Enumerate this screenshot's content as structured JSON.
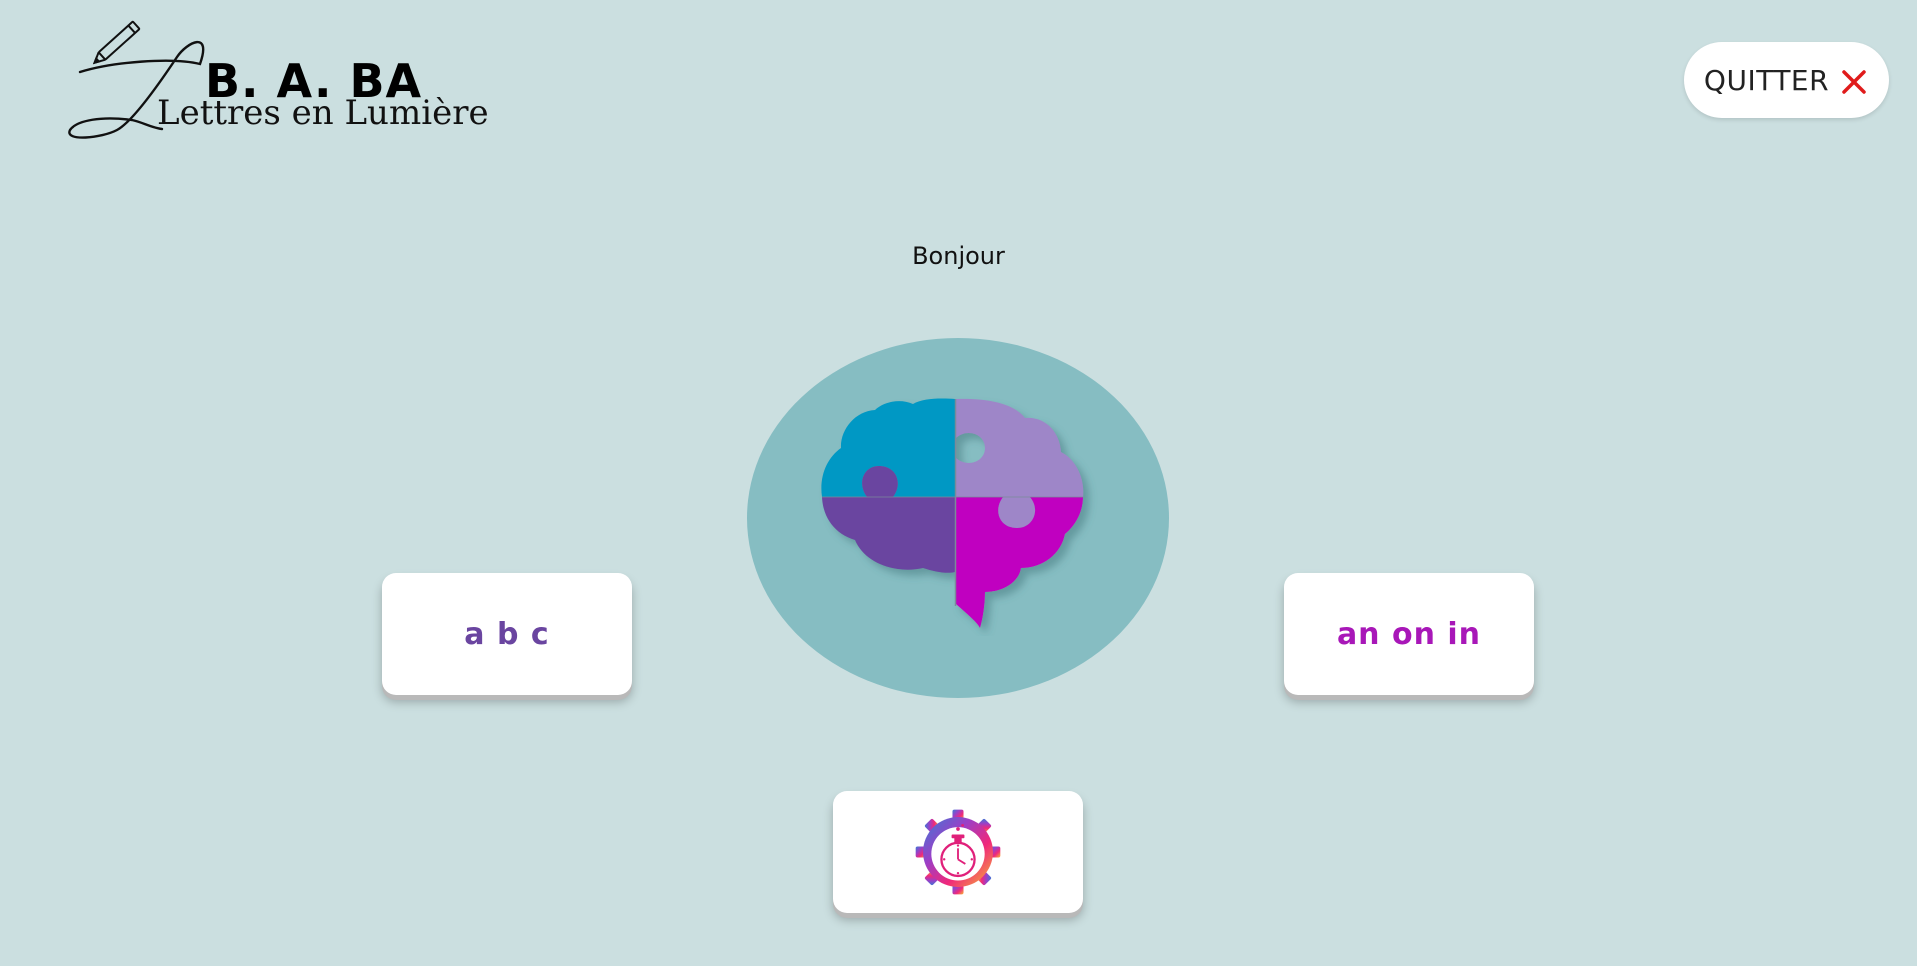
{
  "logo": {
    "title": "B. A. BA",
    "subtitle": "Lettres en Lumière"
  },
  "header": {
    "quit_label": "QUITTER",
    "quit_icon": "close-icon",
    "quit_icon_color": "#e01b1b"
  },
  "main": {
    "greeting": "Bonjour",
    "center_icon": "puzzle-brain-icon"
  },
  "cards": {
    "letters_label": "a b c",
    "letters_color": "#6a45a0",
    "sounds_label": "an on in",
    "sounds_color": "#a817b8",
    "timer_icon": "stopwatch-gear-icon"
  },
  "colors": {
    "background": "#cbdfe0",
    "circle": "#86bdc2",
    "brain_blue": "#0198c4",
    "brain_lilac": "#9e86c8",
    "brain_purple": "#6a45a0",
    "brain_magenta": "#c000c0"
  }
}
